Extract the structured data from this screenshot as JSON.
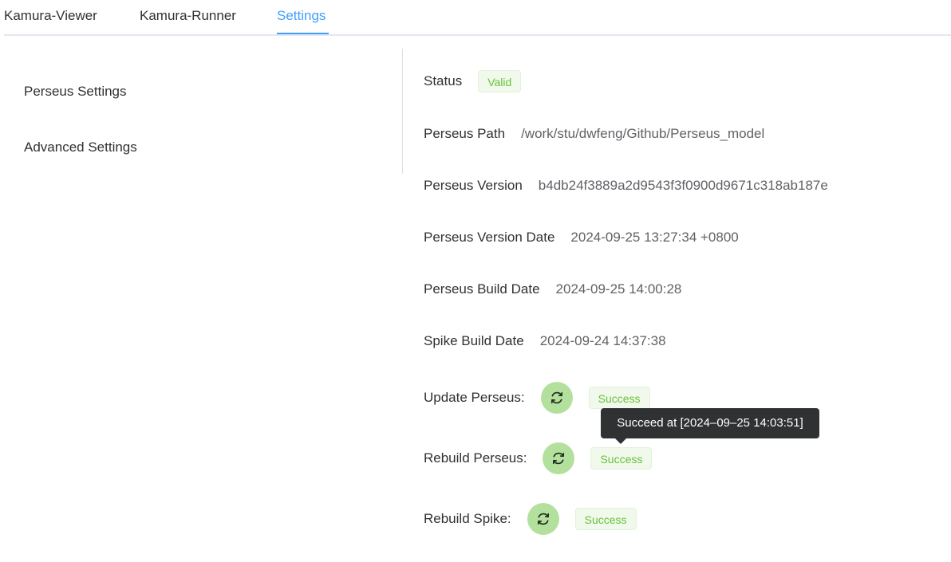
{
  "tabs": [
    {
      "label": "Kamura-Viewer",
      "active": false
    },
    {
      "label": "Kamura-Runner",
      "active": false
    },
    {
      "label": "Settings",
      "active": true
    }
  ],
  "menu": {
    "items": [
      {
        "label": "Perseus Settings"
      },
      {
        "label": "Advanced Settings"
      }
    ]
  },
  "info": {
    "status": {
      "label": "Status",
      "value": "Valid"
    },
    "path": {
      "label": "Perseus Path",
      "value": "/work/stu/dwfeng/Github/Perseus_model"
    },
    "version": {
      "label": "Perseus Version",
      "value": "b4db24f3889a2d9543f3f0900d9671c318ab187e"
    },
    "version_date": {
      "label": "Perseus Version Date",
      "value": "2024-09-25 13:27:34 +0800"
    },
    "build_date": {
      "label": "Perseus Build Date",
      "value": "2024-09-25 14:00:28"
    },
    "spike_build_date": {
      "label": "Spike Build Date",
      "value": "2024-09-24 14:37:38"
    }
  },
  "actions": {
    "update_perseus": {
      "label": "Update Perseus:",
      "status": "Success",
      "icon": "refresh-icon"
    },
    "rebuild_perseus": {
      "label": "Rebuild Perseus:",
      "status": "Success",
      "icon": "refresh-icon"
    },
    "rebuild_spike": {
      "label": "Rebuild Spike:",
      "status": "Success",
      "icon": "refresh-icon"
    }
  },
  "tooltip": {
    "text": "Succeed at [2024–09–25 14:03:51]"
  },
  "colors": {
    "accent": "#409eff",
    "success_text": "#67c23a",
    "success_bg": "#f0f9eb",
    "button_bg": "#b3e19d",
    "tooltip_bg": "#303133"
  }
}
